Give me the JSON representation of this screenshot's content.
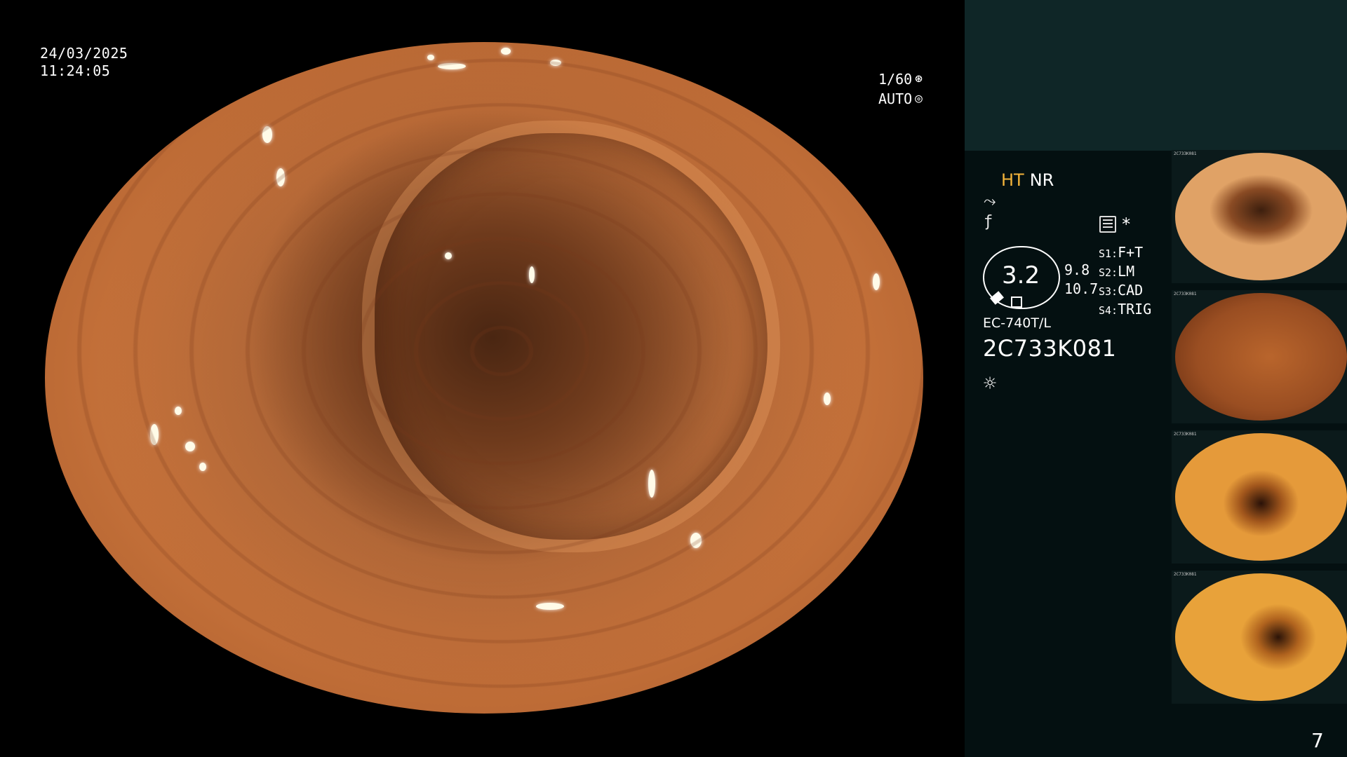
{
  "overlay": {
    "date": "24/03/2025",
    "time": "11:24:05",
    "shutter": "1/60",
    "shutter_icon": "shutter-icon",
    "iris": "AUTO",
    "iris_icon": "iris-icon"
  },
  "panel": {
    "mode_ht": "HT",
    "mode_nr": "NR",
    "icons": [
      "enhancement-icon",
      "contrast-icon",
      "histogram-icon",
      "star-icon",
      "light-source-icon"
    ],
    "star_label": "*",
    "zoom_value": "3.2",
    "zoom_sub": [
      "9.8",
      "10.7"
    ],
    "scope_buttons": [
      {
        "key": "S1:",
        "value": "F+T"
      },
      {
        "key": "S2:",
        "value": "LM"
      },
      {
        "key": "S3:",
        "value": "CAD"
      },
      {
        "key": "S4:",
        "value": "TRIG"
      }
    ],
    "model": "EC-740T/L",
    "serial": "2C733K081",
    "page_number": "7"
  },
  "thumbnails": [
    {
      "caption": "2C733K081"
    },
    {
      "caption": "2C733K081"
    },
    {
      "caption": "2C733K081"
    },
    {
      "caption": "2C733K081"
    }
  ]
}
